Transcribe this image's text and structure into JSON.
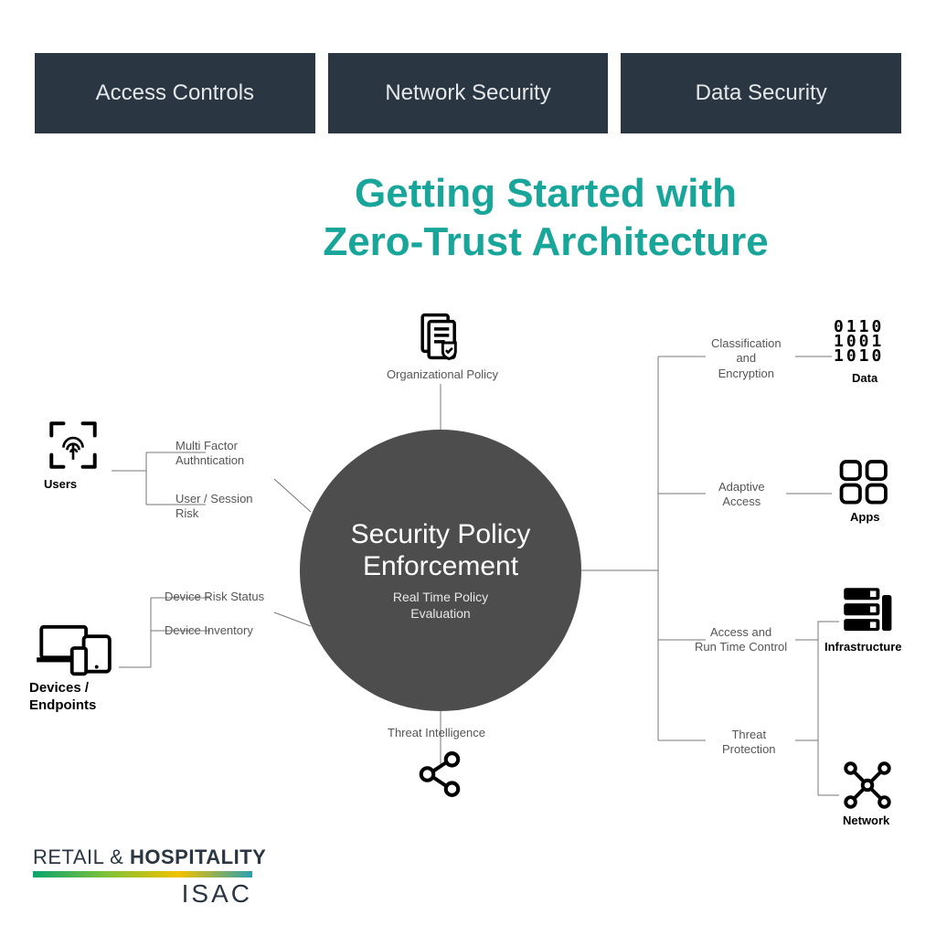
{
  "tabs": [
    "Access Controls",
    "Network Security",
    "Data Security"
  ],
  "title_line1": "Getting Started with",
  "title_line2": "Zero-Trust Architecture",
  "center": {
    "line1": "Security Policy",
    "line2": "Enforcement",
    "sub1": "Real Time Policy",
    "sub2": "Evaluation"
  },
  "nodes": {
    "org_policy": "Organizational Policy",
    "users": "Users",
    "mfa": "Multi Factor\nAuthntication",
    "session_risk": "User / Session\nRisk",
    "device_risk": "Device Risk Status",
    "device_inv": "Device Inventory",
    "devices": "Devices /\nEndpoints",
    "threat_intel": "Threat Intelligence",
    "class_enc": "Classification\nand\nEncryption",
    "data": "Data",
    "adaptive": "Adaptive\nAccess",
    "apps": "Apps",
    "access_runtime": "Access and\nRun Time Control",
    "threat_prot": "Threat\nProtection",
    "infra": "Infrastructure",
    "network": "Network"
  },
  "logo": {
    "line1a": "RETAIL & ",
    "line1b": "HOSPITALITY",
    "line2": "ISAC"
  }
}
